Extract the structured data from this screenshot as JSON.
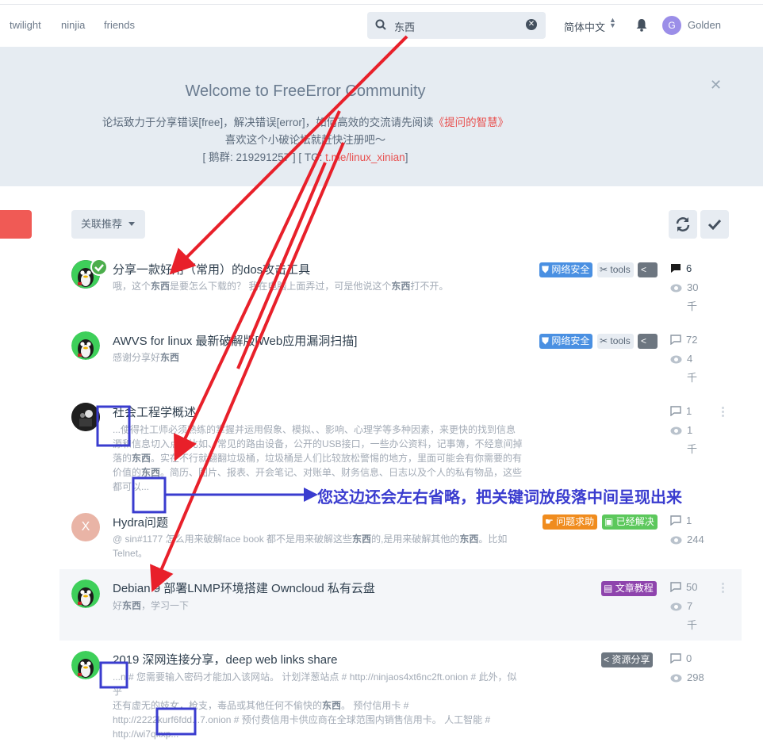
{
  "nav": {
    "links": [
      "twilight",
      "ninjia",
      "friends"
    ],
    "search_value": "东西",
    "language": "简体中文",
    "user_initial": "G",
    "user_name": "Golden"
  },
  "hero": {
    "title": "Welcome to FreeError Community",
    "line1_a": "论坛致力于分享错误[free]，解决错误[error]，如何高效的交流请先阅读",
    "line1_link": "《提问的智慧》",
    "line2": "喜欢这个小破论坛就赶快注册吧～",
    "line3_a": "[ 鹅群: 219291257 ] [ TG: ",
    "line3_link": "t.me/linux_xinian",
    "line3_b": "]"
  },
  "toolbar": {
    "related_label": "关联推荐"
  },
  "posts": [
    {
      "title": "分享一款好用（常用）的dos攻击工具",
      "excerpt_pre": "哦，这个",
      "excerpt_kw1": "东西",
      "excerpt_mid": "是要怎么下载的？ 我在电脑上面弄过，可是他说这个",
      "excerpt_kw2": "东西",
      "excerpt_post": "打不开。",
      "tag1": "网络安全",
      "tag2": "tools",
      "replies": "6",
      "views": "30",
      "views_unit": "千"
    },
    {
      "title": "AWVS for linux 最新破解版[Web应用漏洞扫描]",
      "excerpt_pre": "感谢分享好",
      "excerpt_kw1": "东西",
      "tag1": "网络安全",
      "tag2": "tools",
      "replies": "72",
      "views": "4",
      "views_unit": "千"
    },
    {
      "title": "社会工程学概述",
      "excerpt_l1": "...使得社工师必须熟练的掌握并运用假象、模拟、、影响、心理学等多种因素，来更快的找到信息",
      "excerpt_l2": "源和信息切入点，比如、常见的路由设备，公开的USB接口，一些办公资料，记事簿，不经意间掉",
      "excerpt_l3a": "落的",
      "excerpt_l3kw": "东西",
      "excerpt_l3b": "。实在不行就翻翻垃圾桶，垃圾桶是人们比较放松警惕的地方，里面可能会有你需要的有",
      "excerpt_l4a": "价值的",
      "excerpt_l4kw": "东西",
      "excerpt_l4b": "。简历、图片、报表、开会笔记、对账单、财务信息、日志以及个人的私有物品，这些",
      "excerpt_l5": "都可以...",
      "replies": "1",
      "views": "1",
      "views_unit": "千"
    },
    {
      "title": "Hydra问题",
      "avatar_letter": "X",
      "excerpt_l1a": "@ sin#1177 怎么用来破解face book 都不是用来破解这些",
      "excerpt_l1kw": "东西",
      "excerpt_l1b": "的,是用来破解其他的",
      "excerpt_l1kw2": "东西",
      "excerpt_l1c": "。比如",
      "excerpt_l2": "Telnet。",
      "tag1": "问题求助",
      "tag2": "已经解决",
      "replies": "1",
      "views": "244"
    },
    {
      "title": "Debian 9 部署LNMP环境搭建 Owncloud 私有云盘",
      "excerpt_pre": "好",
      "excerpt_kw1": "东西",
      "excerpt_post": "，学习一下",
      "tag1": "文章教程",
      "replies": "50",
      "views": "7",
      "views_unit": "千"
    },
    {
      "title": "2019 深网连接分享，deep web links share",
      "excerpt_l1": "...n # 您需要输入密码才能加入该网站。 计划洋葱站点 # http://ninjaos4xt6nc2ft.onion # 此外，似乎",
      "excerpt_l2a": "还有虚无的妓女，枪支，毒品或其他任何不偷快的",
      "excerpt_l2kw": "东西",
      "excerpt_l2b": "。 预付信用卡 #",
      "excerpt_l3": "http://2222kurf6fdd...7.onion # 预付费信用卡供应商在全球范围内销售信用卡。 人工智能 #",
      "excerpt_l4": "http://wi7qkxp...",
      "tag1": "资源分享",
      "replies": "0",
      "views": "298"
    }
  ],
  "annotation": {
    "text": "您这边还会左右省略，把关键词放段落中间呈现出来",
    "arrow_color": "#e8202a",
    "box_color": "#3a3ccf"
  },
  "colors": {
    "tag_security": "#4a90e2",
    "tag_tools": "#e7ecf2",
    "tag_help": "#f08c1e",
    "tag_solved": "#5cc85c",
    "tag_article": "#8e44ad",
    "tag_share": "#6d7680",
    "hero_bg": "#e6ecf2"
  }
}
